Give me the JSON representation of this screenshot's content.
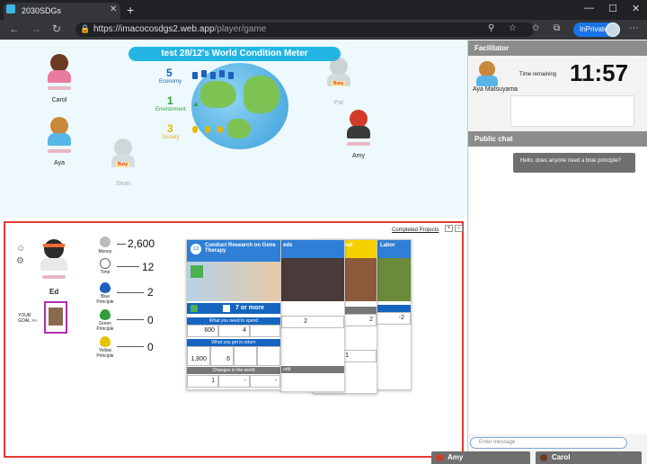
{
  "browser": {
    "tab_title": "2030SDGs",
    "url_host": "https://imacocosdgs2.web.app",
    "url_path": "/player/game",
    "inprivate": "InPrivate",
    "icons": [
      "back-icon",
      "forward-icon",
      "reload-icon",
      "lock-icon",
      "zoom-icon",
      "star-icon",
      "favorites-icon",
      "collections-icon",
      "more-icon"
    ]
  },
  "world": {
    "meter_title": "test 28/12's World Condition Meter",
    "economy": {
      "value": "5",
      "label": "Economy",
      "color": "#1f5fbf"
    },
    "environment": {
      "value": "1",
      "label": "Environment",
      "color": "#2e9d3a"
    },
    "society": {
      "value": "3",
      "label": "Society",
      "color": "#e6b800"
    },
    "players": [
      {
        "name": "Carol"
      },
      {
        "name": "Aya"
      },
      {
        "name": "Sean",
        "busy": "Busy"
      },
      {
        "name": "Pat",
        "busy": "Busy"
      },
      {
        "name": "Amy"
      }
    ]
  },
  "player": {
    "name": "Ed",
    "goal_label": "YOUR GOAL >>",
    "completed_projects": "Completed Projects",
    "money": {
      "label": "Money",
      "value": "2,600"
    },
    "time": {
      "label": "Time",
      "value": "12"
    },
    "blue": {
      "label": "Blue Principle",
      "value": "2"
    },
    "green": {
      "label": "Green Principle",
      "value": "0"
    },
    "yellow": {
      "label": "Yellow Principle",
      "value": "0"
    }
  },
  "cards": {
    "main": {
      "number": "13",
      "title": "Conduct Research on Gene Therapy",
      "requirement": "7 or more",
      "spend_header": "What you need to spend",
      "spend_money": "600",
      "spend_time": "4",
      "return_header": "What you get in return",
      "return_money": "1,800",
      "return_time": "6",
      "changes_header": "Changes in the world",
      "change_economy": "1",
      "change_env": "-",
      "change_society": "-"
    },
    "back_titles": [
      "eds",
      "y Certified",
      "Labor"
    ],
    "back_values": [
      "2",
      "-1",
      "2",
      "-2",
      "more",
      "on",
      "orld"
    ]
  },
  "sidebar": {
    "facilitator_header": "Facilitator",
    "facilitator_name": "Aya Matsuyama",
    "time_label": "Time remaining",
    "time_value": "11:57",
    "chat_header": "Public chat",
    "chat_message": "Hello, does anyone need a blue principle?",
    "chat_placeholder": "Enter message",
    "minimized": [
      "Amy",
      "Carol"
    ]
  },
  "colors": {
    "accent": "#22b5e3",
    "panel_border": "#e53935",
    "card_blue": "#1565c0",
    "card_yellow": "#f5d000",
    "card_header_blue": "#2f7fd6"
  }
}
